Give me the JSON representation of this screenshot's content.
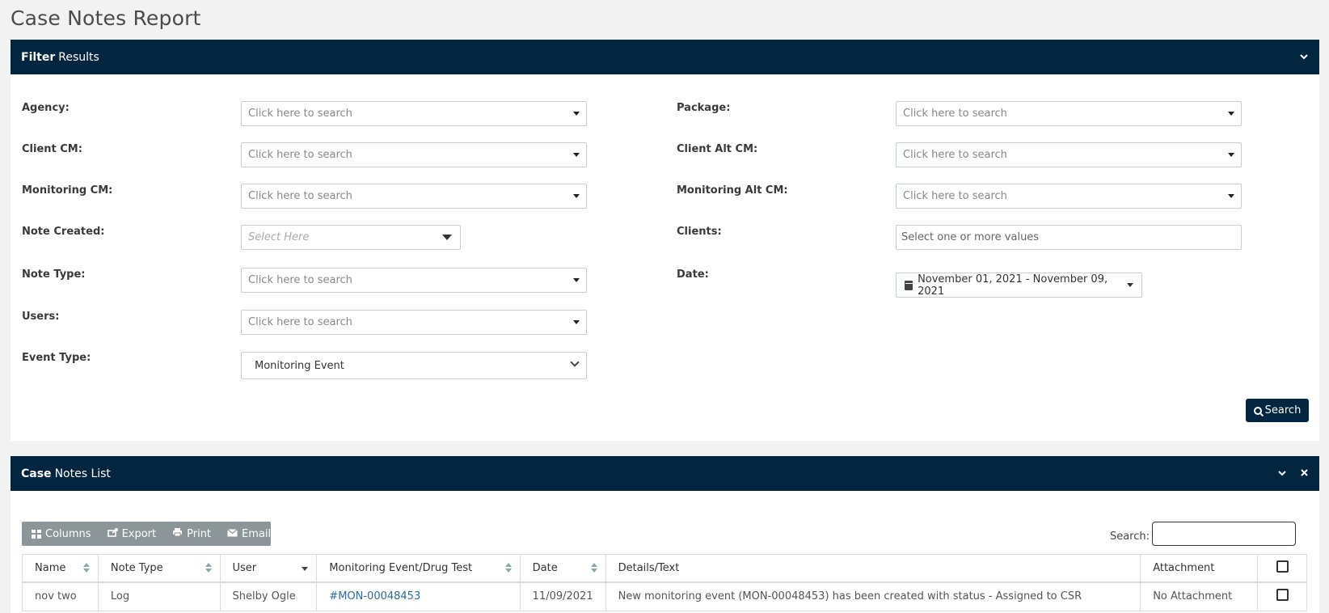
{
  "page": {
    "title": "Case Notes Report"
  },
  "filter_panel": {
    "title_bold": "Filter",
    "title_rest": "Results",
    "collapse_icon": "chevron-down-icon",
    "fields": {
      "agency": {
        "label": "Agency:",
        "placeholder": "Click here to search"
      },
      "package": {
        "label": "Package:",
        "placeholder": "Click here to search"
      },
      "client_cm": {
        "label": "Client CM:",
        "placeholder": "Click here to search"
      },
      "client_alt_cm": {
        "label": "Client Alt CM:",
        "placeholder": "Click here to search"
      },
      "monitoring_cm": {
        "label": "Monitoring CM:",
        "placeholder": "Click here to search"
      },
      "monitoring_alt_cm": {
        "label": "Monitoring Alt CM:",
        "placeholder": "Click here to search"
      },
      "note_created": {
        "label": "Note Created:",
        "placeholder": "Select Here"
      },
      "clients": {
        "label": "Clients:",
        "placeholder": "Select one or more values"
      },
      "note_type": {
        "label": "Note Type:",
        "placeholder": "Click here to search"
      },
      "date": {
        "label": "Date:",
        "value": "November 01, 2021 - November 09, 2021"
      },
      "users": {
        "label": "Users:",
        "placeholder": "Click here to search"
      },
      "event_type": {
        "label": "Event Type:",
        "value": "Monitoring Event"
      }
    },
    "search_button": "Search"
  },
  "list_panel": {
    "title_bold": "Case",
    "title_rest": "Notes List",
    "toolbar": {
      "columns": "Columns",
      "export": "Export",
      "print": "Print",
      "email": "Email"
    },
    "search_label": "Search:",
    "table": {
      "headers": [
        "Name",
        "Note Type",
        "User",
        "Monitoring Event/Drug Test",
        "Date",
        "Details/Text",
        "Attachment"
      ],
      "rows": [
        {
          "name": "nov two",
          "note_type": "Log",
          "user": "Shelby Ogle",
          "event": "#MON-00048453",
          "date": "11/09/2021",
          "details": "New monitoring event (MON-00048453) has been created with status - Assigned to CSR",
          "attachment": "No Attachment"
        }
      ]
    }
  }
}
